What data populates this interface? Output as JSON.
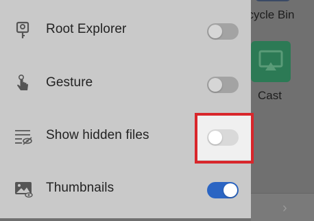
{
  "background": {
    "recycle_bin_label": "ecycle Bin",
    "cast_label": "Cast"
  },
  "drawer": {
    "items": [
      {
        "label": "Root Explorer",
        "icon": "key-icon",
        "enabled": false
      },
      {
        "label": "Gesture",
        "icon": "gesture-hand-icon",
        "enabled": false
      },
      {
        "label": "Show hidden files",
        "icon": "hidden-files-icon",
        "enabled": false,
        "highlighted": true
      },
      {
        "label": "Thumbnails",
        "icon": "image-icon",
        "enabled": true
      }
    ]
  },
  "colors": {
    "drawer_bg": "#c9c9c9",
    "toggle_on": "#2b65c3",
    "highlight_border": "#d8262b"
  }
}
